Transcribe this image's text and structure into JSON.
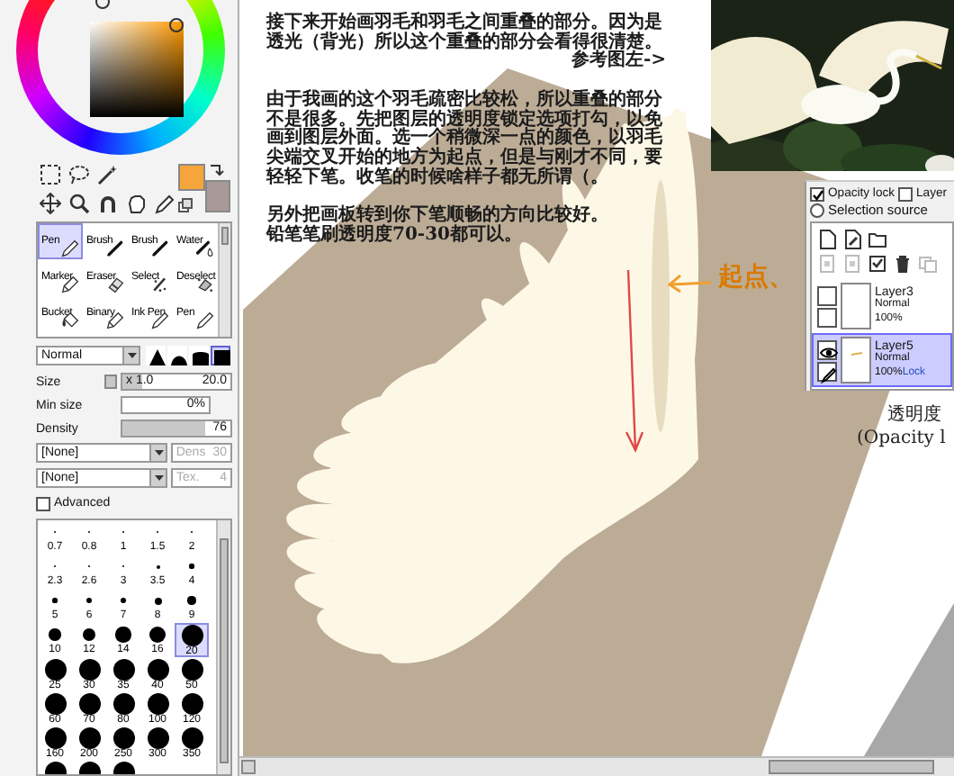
{
  "swatches": [
    {
      "kind": "primary",
      "color": "#f6a53a"
    },
    {
      "kind": "secondary",
      "color": "#a89a98"
    }
  ],
  "tools": [
    {
      "label": "Pen",
      "kind": "pen",
      "selected": true
    },
    {
      "label": "Brush",
      "kind": "brush",
      "selected": false
    },
    {
      "label": "Brush",
      "kind": "brush",
      "selected": false
    },
    {
      "label": "Water",
      "kind": "water",
      "selected": false
    },
    {
      "label": "Marker",
      "kind": "marker",
      "selected": false
    },
    {
      "label": "Eraser",
      "kind": "eraser",
      "selected": false
    },
    {
      "label": "Select",
      "kind": "select",
      "selected": false
    },
    {
      "label": "Deselect",
      "kind": "deselect",
      "selected": false
    },
    {
      "label": "Bucket",
      "kind": "bucket",
      "selected": false
    },
    {
      "label": "Binary",
      "kind": "marker",
      "selected": false
    },
    {
      "label": "Ink Pen",
      "kind": "pen",
      "selected": false
    },
    {
      "label": "Pen",
      "kind": "pen",
      "selected": false
    }
  ],
  "blend_mode": "Normal",
  "brush_shapes": [
    {
      "kind": "pointed",
      "selected": false
    },
    {
      "kind": "soft",
      "selected": false
    },
    {
      "kind": "flat",
      "selected": false
    },
    {
      "kind": "square",
      "selected": true
    }
  ],
  "size": {
    "label": "Size",
    "multiplier": "x 1.0",
    "value": "20.0",
    "level": 0.18
  },
  "min_size": {
    "label": "Min size",
    "value": "0%"
  },
  "density": {
    "label": "Density",
    "value": "76",
    "level": 0.76
  },
  "texture_rows": [
    {
      "select": "[None]",
      "label": "Dens",
      "value": "30",
      "disabled": true
    },
    {
      "select": "[None]",
      "label": "Tex.",
      "value": "4",
      "disabled": true
    }
  ],
  "advanced": {
    "label": "Advanced",
    "checked": false
  },
  "brush_sizes": [
    {
      "label": "0.7",
      "selected": false
    },
    {
      "label": "0.8",
      "selected": false
    },
    {
      "label": "1",
      "selected": false
    },
    {
      "label": "1.5",
      "selected": false
    },
    {
      "label": "2",
      "selected": false
    },
    {
      "label": "2.3",
      "selected": false
    },
    {
      "label": "2.6",
      "selected": false
    },
    {
      "label": "3",
      "selected": false
    },
    {
      "label": "3.5",
      "selected": false
    },
    {
      "label": "4",
      "selected": false
    },
    {
      "label": "5",
      "selected": false
    },
    {
      "label": "6",
      "selected": false
    },
    {
      "label": "7",
      "selected": false
    },
    {
      "label": "8",
      "selected": false
    },
    {
      "label": "9",
      "selected": false
    },
    {
      "label": "10",
      "selected": false
    },
    {
      "label": "12",
      "selected": false
    },
    {
      "label": "14",
      "selected": false
    },
    {
      "label": "16",
      "selected": false
    },
    {
      "label": "20",
      "selected": true
    },
    {
      "label": "25",
      "selected": false
    },
    {
      "label": "30",
      "selected": false
    },
    {
      "label": "35",
      "selected": false
    },
    {
      "label": "40",
      "selected": false
    },
    {
      "label": "50",
      "selected": false
    },
    {
      "label": "60",
      "selected": false
    },
    {
      "label": "70",
      "selected": false
    },
    {
      "label": "80",
      "selected": false
    },
    {
      "label": "100",
      "selected": false
    },
    {
      "label": "120",
      "selected": false
    },
    {
      "label": "160",
      "selected": false
    },
    {
      "label": "200",
      "selected": false
    },
    {
      "label": "250",
      "selected": false
    },
    {
      "label": "300",
      "selected": false
    },
    {
      "label": "350",
      "selected": false
    },
    {
      "selected": false
    },
    {
      "selected": false
    },
    {
      "selected": false
    }
  ],
  "tutorial_text": [
    {
      "kind": "paragraph",
      "text": "接下来开始画羽毛和羽毛之间重叠的部分。因为是透光（背光）所以这个重叠的部分会看得很清楚。"
    },
    {
      "kind": "reference",
      "text": "参考图左->"
    },
    {
      "kind": "paragraph",
      "text": "由于我画的这个羽毛疏密比较松，所以重叠的部分不是很多。先把图层的透明度锁定选项打勾，以免画到图层外面。选一个稍微深一点的颜色，以羽毛尖端交叉开始的地方为起点，但是与刚才不同，要轻轻下笔。收笔的时候啥样子都无所谓（。"
    },
    {
      "kind": "paragraph",
      "text": "另外把画板转到你下笔顺畅的方向比较好。"
    },
    {
      "kind": "line",
      "text": "铅笔笔刷透明度70-30都可以。"
    }
  ],
  "photo": {
    "kind": "picture"
  },
  "annotation": "起点、",
  "layer_panel": {
    "options": [
      {
        "kind": "checkbox",
        "label": "Opacity lock",
        "checked": true
      },
      {
        "kind": "checkbox",
        "label": "Layer",
        "checked": false
      },
      {
        "kind": "radio",
        "label": "Selection source",
        "checked": false
      }
    ],
    "layers": [
      {
        "name": "Layer3",
        "mode": "Normal",
        "opacity": "100%",
        "visible": false,
        "selected": false
      },
      {
        "name": "Layer5",
        "mode": "Normal",
        "opacity": "100%",
        "lock": "Lock",
        "visible": true,
        "selected": true
      }
    ]
  },
  "caption": [
    "透明度",
    "(Opacity l"
  ]
}
